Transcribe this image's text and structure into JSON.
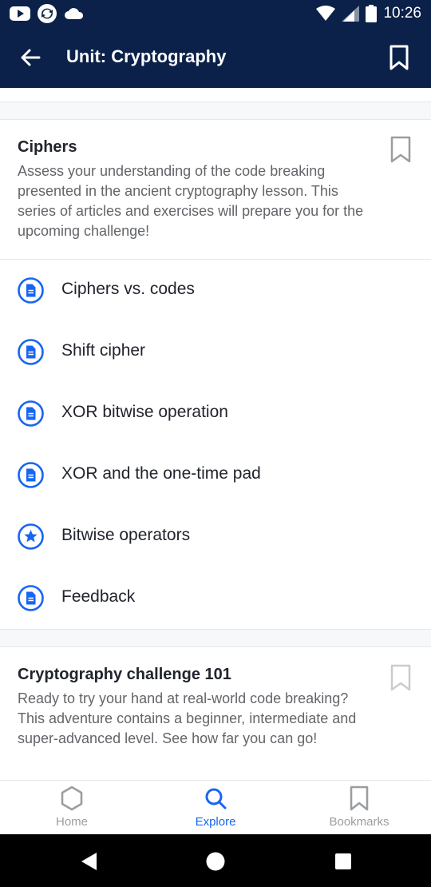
{
  "status_bar": {
    "time": "10:26",
    "left_icons": [
      "youtube-icon",
      "sync-icon",
      "cloud-icon"
    ],
    "right_icons": [
      "wifi-icon",
      "signal-icon",
      "battery-icon"
    ]
  },
  "app_bar": {
    "title": "Unit: Cryptography",
    "back_icon": "arrow-left-icon",
    "bookmark_icon": "bookmark-outline-icon"
  },
  "sections": [
    {
      "title": "Ciphers",
      "description": "Assess your understanding of the code breaking presented in the ancient cryptography lesson. This series of articles and exercises will prepare you for the upcoming challenge!",
      "items": [
        {
          "label": "Ciphers vs. codes",
          "icon": "article-icon"
        },
        {
          "label": "Shift cipher",
          "icon": "article-icon"
        },
        {
          "label": "XOR bitwise operation",
          "icon": "article-icon"
        },
        {
          "label": "XOR and the one-time pad",
          "icon": "article-icon"
        },
        {
          "label": "Bitwise operators",
          "icon": "star-icon"
        },
        {
          "label": "Feedback",
          "icon": "article-icon"
        }
      ]
    },
    {
      "title": "Cryptography challenge 101",
      "description": "Ready to try your hand at real-world code breaking? This adventure contains a beginner, intermediate and super-advanced level. See how far you can go!"
    }
  ],
  "bottom_nav": {
    "items": [
      {
        "label": "Home",
        "icon": "hexagon-icon",
        "active": false
      },
      {
        "label": "Explore",
        "icon": "search-icon",
        "active": true
      },
      {
        "label": "Bookmarks",
        "icon": "bookmark-icon",
        "active": false
      }
    ]
  },
  "colors": {
    "header_bg": "#0b2149",
    "accent": "#1865f2",
    "text": "#21242c",
    "muted_text": "#626569"
  }
}
